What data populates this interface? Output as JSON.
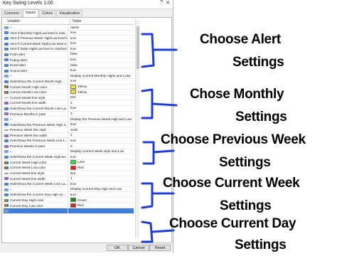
{
  "window": {
    "title": "Key Swing Levels 1.00",
    "help_glyph": "?",
    "close_glyph": "✕"
  },
  "tabs": [
    {
      "label": "Common"
    },
    {
      "label": "Inputs"
    },
    {
      "label": "Colors"
    },
    {
      "label": "Visualization"
    }
  ],
  "grid": {
    "col_variable": "Variable",
    "col_value": "Value",
    "rows": [
      {
        "name": "~",
        "value": "Alerts",
        "icon": "text-icon"
      },
      {
        "name": "Alert if Monthly High/Low level is reac...",
        "value": "true",
        "icon": "bool-icon"
      },
      {
        "name": "Alert if Previous Week High/Low level is...",
        "value": "true",
        "icon": "bool-icon"
      },
      {
        "name": "Alert if Current Week High/Low level is r...",
        "value": "true",
        "icon": "bool-icon"
      },
      {
        "name": "Alert if Daily High/Low level is reached",
        "value": "true",
        "icon": "bool-icon"
      },
      {
        "name": "Push alert",
        "value": "false",
        "icon": "bool-icon"
      },
      {
        "name": "Popup alert",
        "value": "true",
        "icon": "bool-icon"
      },
      {
        "name": "Email alert",
        "value": "false",
        "icon": "bool-icon"
      },
      {
        "name": "Sound alert",
        "value": "true",
        "icon": "bool-icon"
      },
      {
        "name": "~",
        "value": "Display Current Monthly Highs and Lows",
        "icon": "text-icon"
      },
      {
        "name": "Hide/Show the Current Month High ...",
        "value": "true",
        "icon": "bool-icon"
      },
      {
        "name": "Current Month High color",
        "value": "Yellow",
        "icon": "color-icon",
        "swatch": "#f2e23a"
      },
      {
        "name": "Current Month Low color",
        "value": "Yellow",
        "icon": "color-icon",
        "swatch": "#f2e23a"
      },
      {
        "name": "Current Month line style",
        "value": "Dot",
        "icon": "style-icon"
      },
      {
        "name": "Current Month line width",
        "value": "1",
        "icon": "int-icon"
      },
      {
        "name": "Hide/Show the Current Month Line La...",
        "value": "true",
        "icon": "bool-icon"
      },
      {
        "name": "Previous Months in past",
        "value": "3",
        "icon": "int-icon"
      },
      {
        "name": "~",
        "value": "Display the Previous Week High and Low",
        "icon": "text-icon"
      },
      {
        "name": "Hide/Show the Previous Week High a...",
        "value": "true",
        "icon": "bool-icon"
      },
      {
        "name": "Previous Week line style",
        "value": "Solid",
        "icon": "style-icon"
      },
      {
        "name": "Previous Week line width",
        "value": "1",
        "icon": "int-icon"
      },
      {
        "name": "Hide/Show the Previous Week Line L...",
        "value": "true",
        "icon": "bool-icon"
      },
      {
        "name": "Previous Weeks in past",
        "value": "3",
        "icon": "int-icon"
      },
      {
        "name": "~",
        "value": "Display Current Week High and Low",
        "icon": "text-icon"
      },
      {
        "name": "Hide/Show the Current Week High an...",
        "value": "true",
        "icon": "bool-icon"
      },
      {
        "name": "Current Week High color",
        "value": "Lime",
        "icon": "color-icon",
        "swatch": "#3ce03c"
      },
      {
        "name": "Current Week Low color",
        "value": "Red",
        "icon": "color-icon",
        "swatch": "#e02020"
      },
      {
        "name": "Current Week line style",
        "value": "Dot",
        "icon": "style-icon"
      },
      {
        "name": "Current Week line width",
        "value": "1",
        "icon": "int-icon"
      },
      {
        "name": "Hide/Show the Current Week Line La...",
        "value": "true",
        "icon": "bool-icon"
      },
      {
        "name": "~",
        "value": "Display Current Day High and Low",
        "icon": "text-icon"
      },
      {
        "name": "Hide/Show the Current Day High an...",
        "value": "true",
        "icon": "bool-icon"
      },
      {
        "name": "Current Day High color",
        "value": "Green",
        "icon": "color-icon",
        "swatch": "#1a8a1a"
      },
      {
        "name": "Current Day Low color",
        "value": "Red",
        "icon": "color-icon",
        "swatch": "#e02020"
      },
      {
        "name": "",
        "value": "",
        "icon": "text-icon",
        "selected": true
      }
    ]
  },
  "load_label": "oad",
  "buttons": {
    "ok": "OK",
    "cancel": "Cancel",
    "reset": "Reset"
  },
  "annotations": [
    {
      "line1": "Choose Alert",
      "line2": "Settings"
    },
    {
      "line1": "Chose Monthly",
      "line2": "Settings"
    },
    {
      "line1": "Choose Previous Week",
      "line2": "Settings"
    },
    {
      "line1": "Choose Current Week",
      "line2": "Settings"
    },
    {
      "line1": "Choose Current Day",
      "line2": "Settings"
    }
  ],
  "colors": {
    "brace": "#1d3fd8",
    "selection": "#3e7ed8"
  }
}
